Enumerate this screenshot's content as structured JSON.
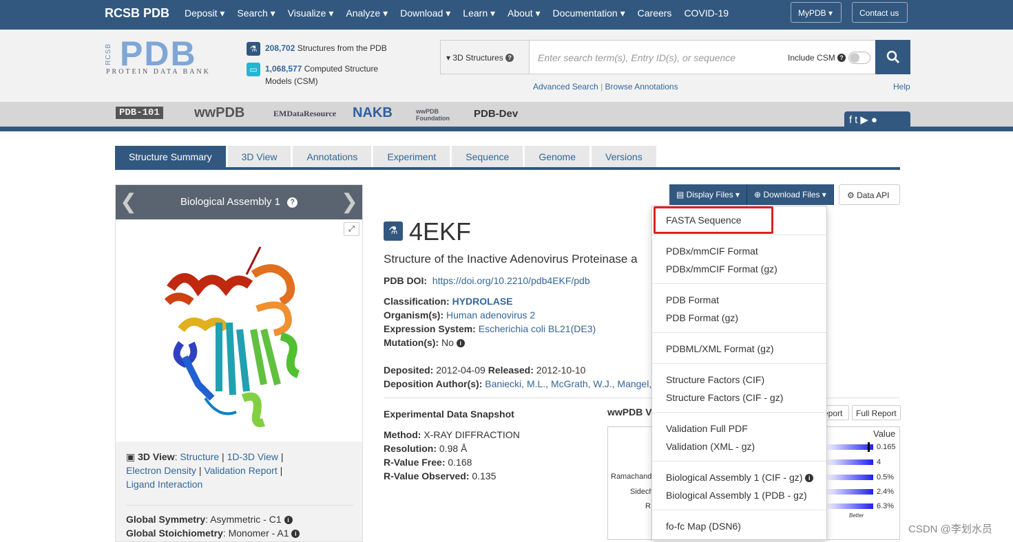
{
  "nav": {
    "brand": "RCSB PDB",
    "menu": [
      "Deposit ▾",
      "Search ▾",
      "Visualize ▾",
      "Analyze ▾",
      "Download ▾",
      "Learn ▾",
      "About ▾",
      "Documentation ▾",
      "Careers",
      "COVID-19"
    ],
    "mypdb": "MyPDB ▾",
    "contact": "Contact us"
  },
  "header": {
    "logo_side": "RCSB",
    "logo_main": "PDB",
    "logo_sub": "PROTEIN DATA BANK",
    "stat1_count": "208,702",
    "stat1_text": " Structures from the PDB",
    "stat2_count": "1,068,577",
    "stat2_text": " Computed Structure",
    "stat2_text2": "Models (CSM)",
    "search_scope": "3D Structures",
    "search_placeholder": "Enter search term(s), Entry ID(s), or sequence",
    "include_csm": "Include CSM",
    "advanced_search": "Advanced Search",
    "browse_annotations": "Browse Annotations",
    "help": "Help"
  },
  "partners": [
    "PDB-101",
    "wwPDB",
    "EMDataResource",
    "NAKB",
    "wwPDB Foundation",
    "PDB-Dev"
  ],
  "tabs": [
    "Structure Summary",
    "3D View",
    "Annotations",
    "Experiment",
    "Sequence",
    "Genome",
    "Versions"
  ],
  "left_panel": {
    "title": "Biological Assembly 1",
    "view_label": "3D View",
    "link_structure": "Structure",
    "link_1d3d": "1D-3D View",
    "link_density": "Electron Density",
    "link_validation": "Validation Report",
    "link_ligand": "Ligand Interaction",
    "sym_label": "Global Symmetry",
    "sym_value": "Asymmetric - C1",
    "stoich_label": "Global Stoichiometry",
    "stoich_value": "Monomer - A1"
  },
  "entry": {
    "id": "4EKF",
    "title": "Structure of the Inactive Adenovirus Proteinase a",
    "doi_label": "PDB DOI:",
    "doi": "https://doi.org/10.2210/pdb4EKF/pdb",
    "classification_label": "Classification:",
    "classification": "HYDROLASE",
    "organism_label": "Organism(s):",
    "organism": "Human adenovirus 2",
    "expression_label": "Expression System:",
    "expression": "Escherichia coli BL21(DE3)",
    "mutation_label": "Mutation(s):",
    "mutation": "No",
    "deposited_label": "Deposited:",
    "deposited": "2012-04-09",
    "released_label": "Released:",
    "released": "2012-10-10",
    "authors_label": "Deposition Author(s):",
    "authors": "Baniecki, M.L., McGrath, W.J., Mangel,"
  },
  "snapshot": {
    "title": "Experimental Data Snapshot",
    "method_label": "Method:",
    "method": "X-RAY DIFFRACTION",
    "resolution_label": "Resolution:",
    "resolution": "0.98 Å",
    "rfree_label": "R-Value Free:",
    "rfree": "0.168",
    "robs_label": "R-Value Observed:",
    "robs": "0.135"
  },
  "validation": {
    "title": "wwPDB Va",
    "report_btn": "eport",
    "full_report_btn": "Full Report",
    "value_header": "Value",
    "rows": [
      {
        "label": "",
        "value": "0.165"
      },
      {
        "label": "",
        "value": "4"
      },
      {
        "label": "Ramachand",
        "value": "0.5%"
      },
      {
        "label": "Sidech",
        "value": "2.4%"
      },
      {
        "label": "RS",
        "value": "6.3%"
      }
    ],
    "better": "Better"
  },
  "files": {
    "display": "Display Files ▾",
    "download": "Download Files ▾",
    "data_api": "Data API"
  },
  "dropdown": [
    "FASTA Sequence",
    "PDBx/mmCIF Format",
    "PDBx/mmCIF Format (gz)",
    "PDB Format",
    "PDB Format (gz)",
    "PDBML/XML Format (gz)",
    "Structure Factors (CIF)",
    "Structure Factors (CIF - gz)",
    "Validation Full PDF",
    "Validation (XML - gz)",
    "Biological Assembly 1 (CIF - gz)",
    "Biological Assembly 1 (PDB - gz)",
    "fo-fc Map (DSN6)"
  ],
  "watermark": "CSDN @李划水员",
  "colors": {
    "primary": "#325880",
    "link": "#336699",
    "highlight": "#e02020"
  }
}
